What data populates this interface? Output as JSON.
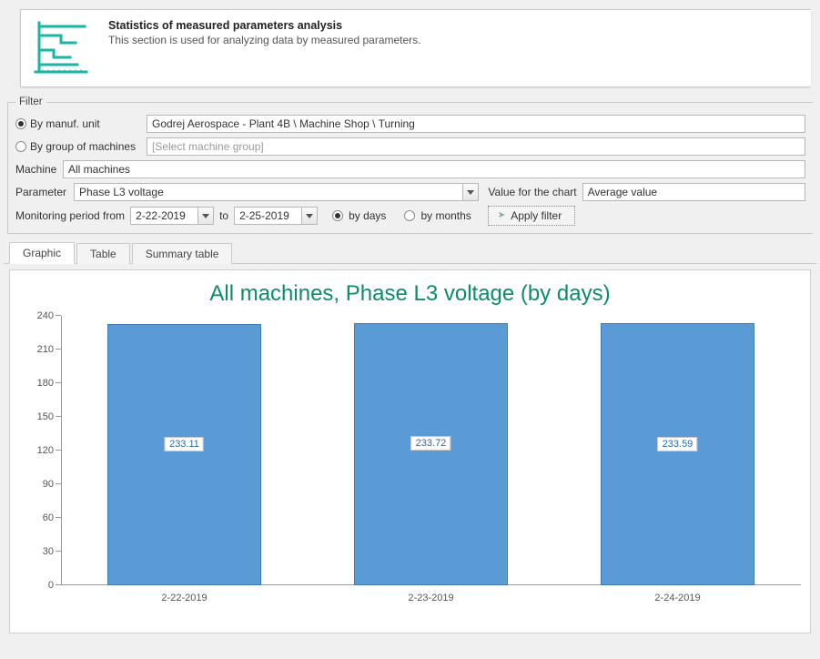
{
  "header": {
    "title": "Statistics of measured parameters analysis",
    "desc": "This section is used for analyzing data by measured parameters."
  },
  "filter": {
    "legend": "Filter",
    "by_unit_label": "By manuf. unit",
    "by_group_label": "By group of machines",
    "selected_mode": "unit",
    "unit_value": "Godrej Aerospace - Plant 4B \\ Machine Shop \\ Turning",
    "group_placeholder": "[Select machine group]",
    "machine_label": "Machine",
    "machine_value": "All machines",
    "parameter_label": "Parameter",
    "parameter_value": "Phase L3 voltage",
    "value_for_chart_label": "Value for the chart",
    "value_for_chart_value": "Average value",
    "monitoring_period_from_label": "Monitoring period from",
    "to_label": "to",
    "date_from": "2-22-2019",
    "date_to": "2-25-2019",
    "interval_selected": "days",
    "by_days_label": "by days",
    "by_months_label": "by months",
    "apply_label": "Apply filter"
  },
  "tabs": {
    "graphic": "Graphic",
    "table": "Table",
    "summary": "Summary table",
    "active": "graphic"
  },
  "chart_title": "All machines, Phase L3 voltage (by days)",
  "chart_data": {
    "type": "bar",
    "title": "All machines, Phase L3 voltage (by days)",
    "categories": [
      "2-22-2019",
      "2-23-2019",
      "2-24-2019"
    ],
    "values": [
      233.11,
      233.72,
      233.59
    ],
    "xlabel": "",
    "ylabel": "",
    "ylim": [
      0,
      240
    ],
    "yticks": [
      0,
      30,
      60,
      90,
      120,
      150,
      180,
      210,
      240
    ]
  },
  "colors": {
    "accent_teal": "#0e8b6b",
    "bar_fill": "#5a9bd5",
    "bar_border": "#3f7bb5"
  }
}
